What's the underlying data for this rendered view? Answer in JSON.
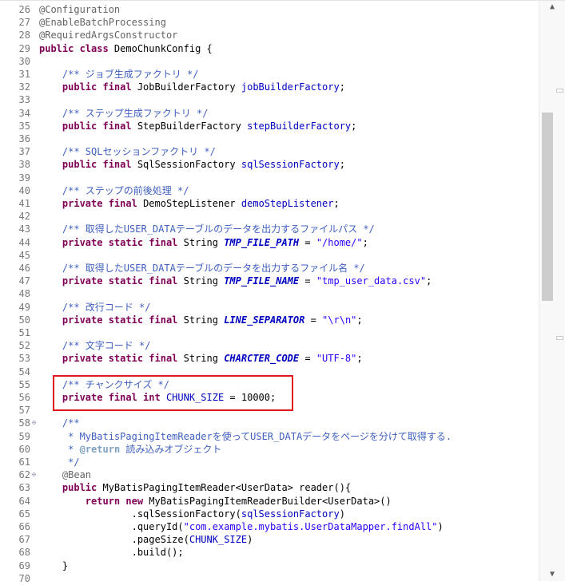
{
  "editor": {
    "lines": [
      {
        "n": "26",
        "fold": "",
        "t": [
          [
            "an",
            "@Configuration"
          ]
        ]
      },
      {
        "n": "27",
        "fold": "",
        "t": [
          [
            "an",
            "@EnableBatchProcessing"
          ]
        ]
      },
      {
        "n": "28",
        "fold": "",
        "t": [
          [
            "an",
            "@RequiredArgsConstructor"
          ]
        ]
      },
      {
        "n": "29",
        "fold": "",
        "t": [
          [
            "kw",
            "public class "
          ],
          [
            "pl",
            "DemoChunkConfig {"
          ]
        ]
      },
      {
        "n": "30",
        "fold": "",
        "t": []
      },
      {
        "n": "31",
        "fold": "",
        "t": [
          [
            "pl",
            "    "
          ],
          [
            "cm",
            "/** ジョブ生成ファクトリ */"
          ]
        ]
      },
      {
        "n": "32",
        "fold": "",
        "t": [
          [
            "pl",
            "    "
          ],
          [
            "kw",
            "public final "
          ],
          [
            "pl",
            "JobBuilderFactory "
          ],
          [
            "fd",
            "jobBuilderFactory"
          ],
          [
            "pl",
            ";"
          ]
        ]
      },
      {
        "n": "33",
        "fold": "",
        "t": []
      },
      {
        "n": "34",
        "fold": "",
        "t": [
          [
            "pl",
            "    "
          ],
          [
            "cm",
            "/** ステップ生成ファクトリ */"
          ]
        ]
      },
      {
        "n": "35",
        "fold": "",
        "t": [
          [
            "pl",
            "    "
          ],
          [
            "kw",
            "public final "
          ],
          [
            "pl",
            "StepBuilderFactory "
          ],
          [
            "fd",
            "stepBuilderFactory"
          ],
          [
            "pl",
            ";"
          ]
        ]
      },
      {
        "n": "36",
        "fold": "",
        "t": []
      },
      {
        "n": "37",
        "fold": "",
        "t": [
          [
            "pl",
            "    "
          ],
          [
            "cm",
            "/** SQLセッションファクトリ */"
          ]
        ]
      },
      {
        "n": "38",
        "fold": "",
        "t": [
          [
            "pl",
            "    "
          ],
          [
            "kw",
            "public final "
          ],
          [
            "pl",
            "SqlSessionFactory "
          ],
          [
            "fd",
            "sqlSessionFactory"
          ],
          [
            "pl",
            ";"
          ]
        ]
      },
      {
        "n": "39",
        "fold": "",
        "t": []
      },
      {
        "n": "40",
        "fold": "",
        "t": [
          [
            "pl",
            "    "
          ],
          [
            "cm",
            "/** ステップの前後処理 */"
          ]
        ]
      },
      {
        "n": "41",
        "fold": "",
        "t": [
          [
            "pl",
            "    "
          ],
          [
            "kw",
            "private final "
          ],
          [
            "pl",
            "DemoStepListener "
          ],
          [
            "fd",
            "demoStepListener"
          ],
          [
            "pl",
            ";"
          ]
        ]
      },
      {
        "n": "42",
        "fold": "",
        "t": []
      },
      {
        "n": "43",
        "fold": "",
        "t": [
          [
            "pl",
            "    "
          ],
          [
            "cm",
            "/** 取得したUSER_DATAテーブルのデータを出力するファイルパス */"
          ]
        ]
      },
      {
        "n": "44",
        "fold": "",
        "t": [
          [
            "pl",
            "    "
          ],
          [
            "kw",
            "private static final "
          ],
          [
            "pl",
            "String "
          ],
          [
            "st",
            "TMP_FILE_PATH"
          ],
          [
            "pl",
            " = "
          ],
          [
            "str",
            "\"/home/\""
          ],
          [
            "pl",
            ";"
          ]
        ]
      },
      {
        "n": "45",
        "fold": "",
        "t": []
      },
      {
        "n": "46",
        "fold": "",
        "t": [
          [
            "pl",
            "    "
          ],
          [
            "cm",
            "/** 取得したUSER_DATAテーブルのデータを出力するファイル名 */"
          ]
        ]
      },
      {
        "n": "47",
        "fold": "",
        "t": [
          [
            "pl",
            "    "
          ],
          [
            "kw",
            "private static final "
          ],
          [
            "pl",
            "String "
          ],
          [
            "st",
            "TMP_FILE_NAME"
          ],
          [
            "pl",
            " = "
          ],
          [
            "str",
            "\"tmp_user_data.csv\""
          ],
          [
            "pl",
            ";"
          ]
        ]
      },
      {
        "n": "48",
        "fold": "",
        "t": []
      },
      {
        "n": "49",
        "fold": "",
        "t": [
          [
            "pl",
            "    "
          ],
          [
            "cm",
            "/** 改行コード */"
          ]
        ]
      },
      {
        "n": "50",
        "fold": "",
        "t": [
          [
            "pl",
            "    "
          ],
          [
            "kw",
            "private static final "
          ],
          [
            "pl",
            "String "
          ],
          [
            "st",
            "LINE_SEPARATOR"
          ],
          [
            "pl",
            " = "
          ],
          [
            "str",
            "\"\\r\\n\""
          ],
          [
            "pl",
            ";"
          ]
        ]
      },
      {
        "n": "51",
        "fold": "",
        "t": []
      },
      {
        "n": "52",
        "fold": "",
        "t": [
          [
            "pl",
            "    "
          ],
          [
            "cm",
            "/** 文字コード */"
          ]
        ]
      },
      {
        "n": "53",
        "fold": "",
        "t": [
          [
            "pl",
            "    "
          ],
          [
            "kw",
            "private static final "
          ],
          [
            "pl",
            "String "
          ],
          [
            "st",
            "CHARCTER_CODE"
          ],
          [
            "pl",
            " = "
          ],
          [
            "str",
            "\"UTF-8\""
          ],
          [
            "pl",
            ";"
          ]
        ]
      },
      {
        "n": "54",
        "fold": "",
        "t": []
      },
      {
        "n": "55",
        "fold": "",
        "t": [
          [
            "pl",
            "    "
          ],
          [
            "cm",
            "/** チャンクサイズ */"
          ]
        ]
      },
      {
        "n": "56",
        "fold": "",
        "t": [
          [
            "pl",
            "    "
          ],
          [
            "kw",
            "private final int "
          ],
          [
            "fd",
            "CHUNK_SIZE"
          ],
          [
            "pl",
            " = 10000;"
          ]
        ]
      },
      {
        "n": "57",
        "fold": "",
        "t": []
      },
      {
        "n": "58",
        "fold": "⊖",
        "t": [
          [
            "pl",
            "    "
          ],
          [
            "cm",
            "/**"
          ]
        ]
      },
      {
        "n": "59",
        "fold": "",
        "t": [
          [
            "pl",
            "    "
          ],
          [
            "cm",
            " * MyBatisPagingItemReaderを使ってUSER_DATAデータをページを分けて取得する."
          ]
        ]
      },
      {
        "n": "60",
        "fold": "",
        "t": [
          [
            "pl",
            "    "
          ],
          [
            "cm",
            " * "
          ],
          [
            "jd",
            "@return"
          ],
          [
            "cm",
            " 読み込みオブジェクト"
          ]
        ]
      },
      {
        "n": "61",
        "fold": "",
        "t": [
          [
            "pl",
            "    "
          ],
          [
            "cm",
            " */"
          ]
        ]
      },
      {
        "n": "62",
        "fold": "⊖",
        "t": [
          [
            "pl",
            "    "
          ],
          [
            "an",
            "@Bean"
          ]
        ]
      },
      {
        "n": "63",
        "fold": "",
        "t": [
          [
            "pl",
            "    "
          ],
          [
            "kw",
            "public "
          ],
          [
            "pl",
            "MyBatisPagingItemReader<UserData> reader(){"
          ]
        ]
      },
      {
        "n": "64",
        "fold": "",
        "t": [
          [
            "pl",
            "        "
          ],
          [
            "kw",
            "return new "
          ],
          [
            "pl",
            "MyBatisPagingItemReaderBuilder<UserData>()"
          ]
        ]
      },
      {
        "n": "65",
        "fold": "",
        "t": [
          [
            "pl",
            "                .sqlSessionFactory("
          ],
          [
            "fd",
            "sqlSessionFactory"
          ],
          [
            "pl",
            ")"
          ]
        ]
      },
      {
        "n": "66",
        "fold": "",
        "t": [
          [
            "pl",
            "                .queryId("
          ],
          [
            "str",
            "\"com.example.mybatis.UserDataMapper.findAll\""
          ],
          [
            "pl",
            ")"
          ]
        ]
      },
      {
        "n": "67",
        "fold": "",
        "t": [
          [
            "pl",
            "                .pageSize("
          ],
          [
            "fd",
            "CHUNK_SIZE"
          ],
          [
            "pl",
            ")"
          ]
        ]
      },
      {
        "n": "68",
        "fold": "",
        "t": [
          [
            "pl",
            "                .build();"
          ]
        ]
      },
      {
        "n": "69",
        "fold": "",
        "t": [
          [
            "pl",
            "    }"
          ]
        ]
      },
      {
        "n": "70",
        "fold": "",
        "t": []
      }
    ]
  },
  "scrollbar": {
    "up_arrow": "▲",
    "down_arrow": "▼"
  }
}
